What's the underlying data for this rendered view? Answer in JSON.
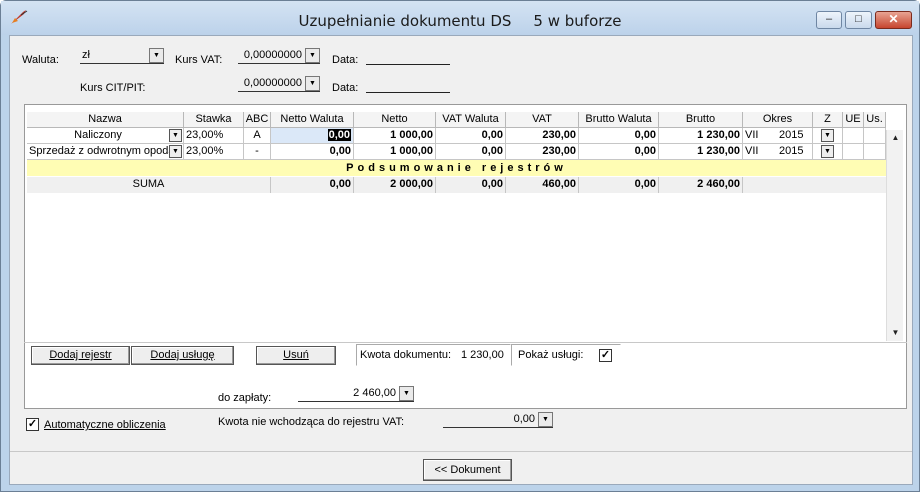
{
  "window": {
    "title": "Uzupełnianie dokumentu DS",
    "subtitle": "5 w buforze",
    "min_glyph": "–",
    "max_glyph": "□",
    "close_glyph": "✕"
  },
  "header": {
    "waluta_label": "Waluta:",
    "waluta_value": "zł",
    "kurs_vat_label": "Kurs VAT:",
    "kurs_vat_value": "0,00000000",
    "data1_label": "Data:",
    "kurs_cit_label": "Kurs CIT/PIT:",
    "kurs_cit_value": "0,00000000",
    "data2_label": "Data:"
  },
  "table": {
    "columns": [
      "Nazwa",
      "Stawka",
      "ABC",
      "Netto Waluta",
      "Netto",
      "VAT Waluta",
      "VAT",
      "Brutto Waluta",
      "Brutto",
      "Okres",
      "Z",
      "UE",
      "Us."
    ],
    "rows": [
      {
        "nazwa": "Naliczony",
        "stawka": "23,00%",
        "abc": "A",
        "netto_waluta": "0,00",
        "netto": "1 000,00",
        "vat_waluta": "0,00",
        "vat": "230,00",
        "brutto_waluta": "0,00",
        "brutto": "1 230,00",
        "okres_m": "VII",
        "okres_y": "2015"
      },
      {
        "nazwa": "Sprzedaż z odwrotnym opoda",
        "stawka": "23,00%",
        "abc": "-",
        "netto_waluta": "0,00",
        "netto": "1 000,00",
        "vat_waluta": "0,00",
        "vat": "230,00",
        "brutto_waluta": "0,00",
        "brutto": "1 230,00",
        "okres_m": "VII",
        "okres_y": "2015"
      }
    ],
    "summary_banner": "Podsumowanie rejestrów",
    "sum": {
      "label": "SUMA",
      "netto_waluta": "0,00",
      "netto": "2 000,00",
      "vat_waluta": "0,00",
      "vat": "460,00",
      "brutto_waluta": "0,00",
      "brutto": "2 460,00"
    }
  },
  "buttons": {
    "dodaj_rejestr": "Dodaj rejestr",
    "dodaj_usluge": "Dodaj usługę",
    "usun": "Usuń",
    "dokument": "<< Dokument"
  },
  "status": {
    "kwota_label": "Kwota dokumentu:",
    "kwota_value": "1 230,00",
    "pokaz_uslugi_label": "Pokaż usługi:",
    "pokaz_uslugi_checked": true
  },
  "footer": {
    "do_zaplaty_label": "do zapłaty:",
    "do_zaplaty_value": "2 460,00",
    "kwota_nie_label": "Kwota nie wchodząca do rejestru VAT:",
    "kwota_nie_value": "0,00",
    "auto_label": "Automatyczne obliczenia",
    "auto_checked": true
  }
}
